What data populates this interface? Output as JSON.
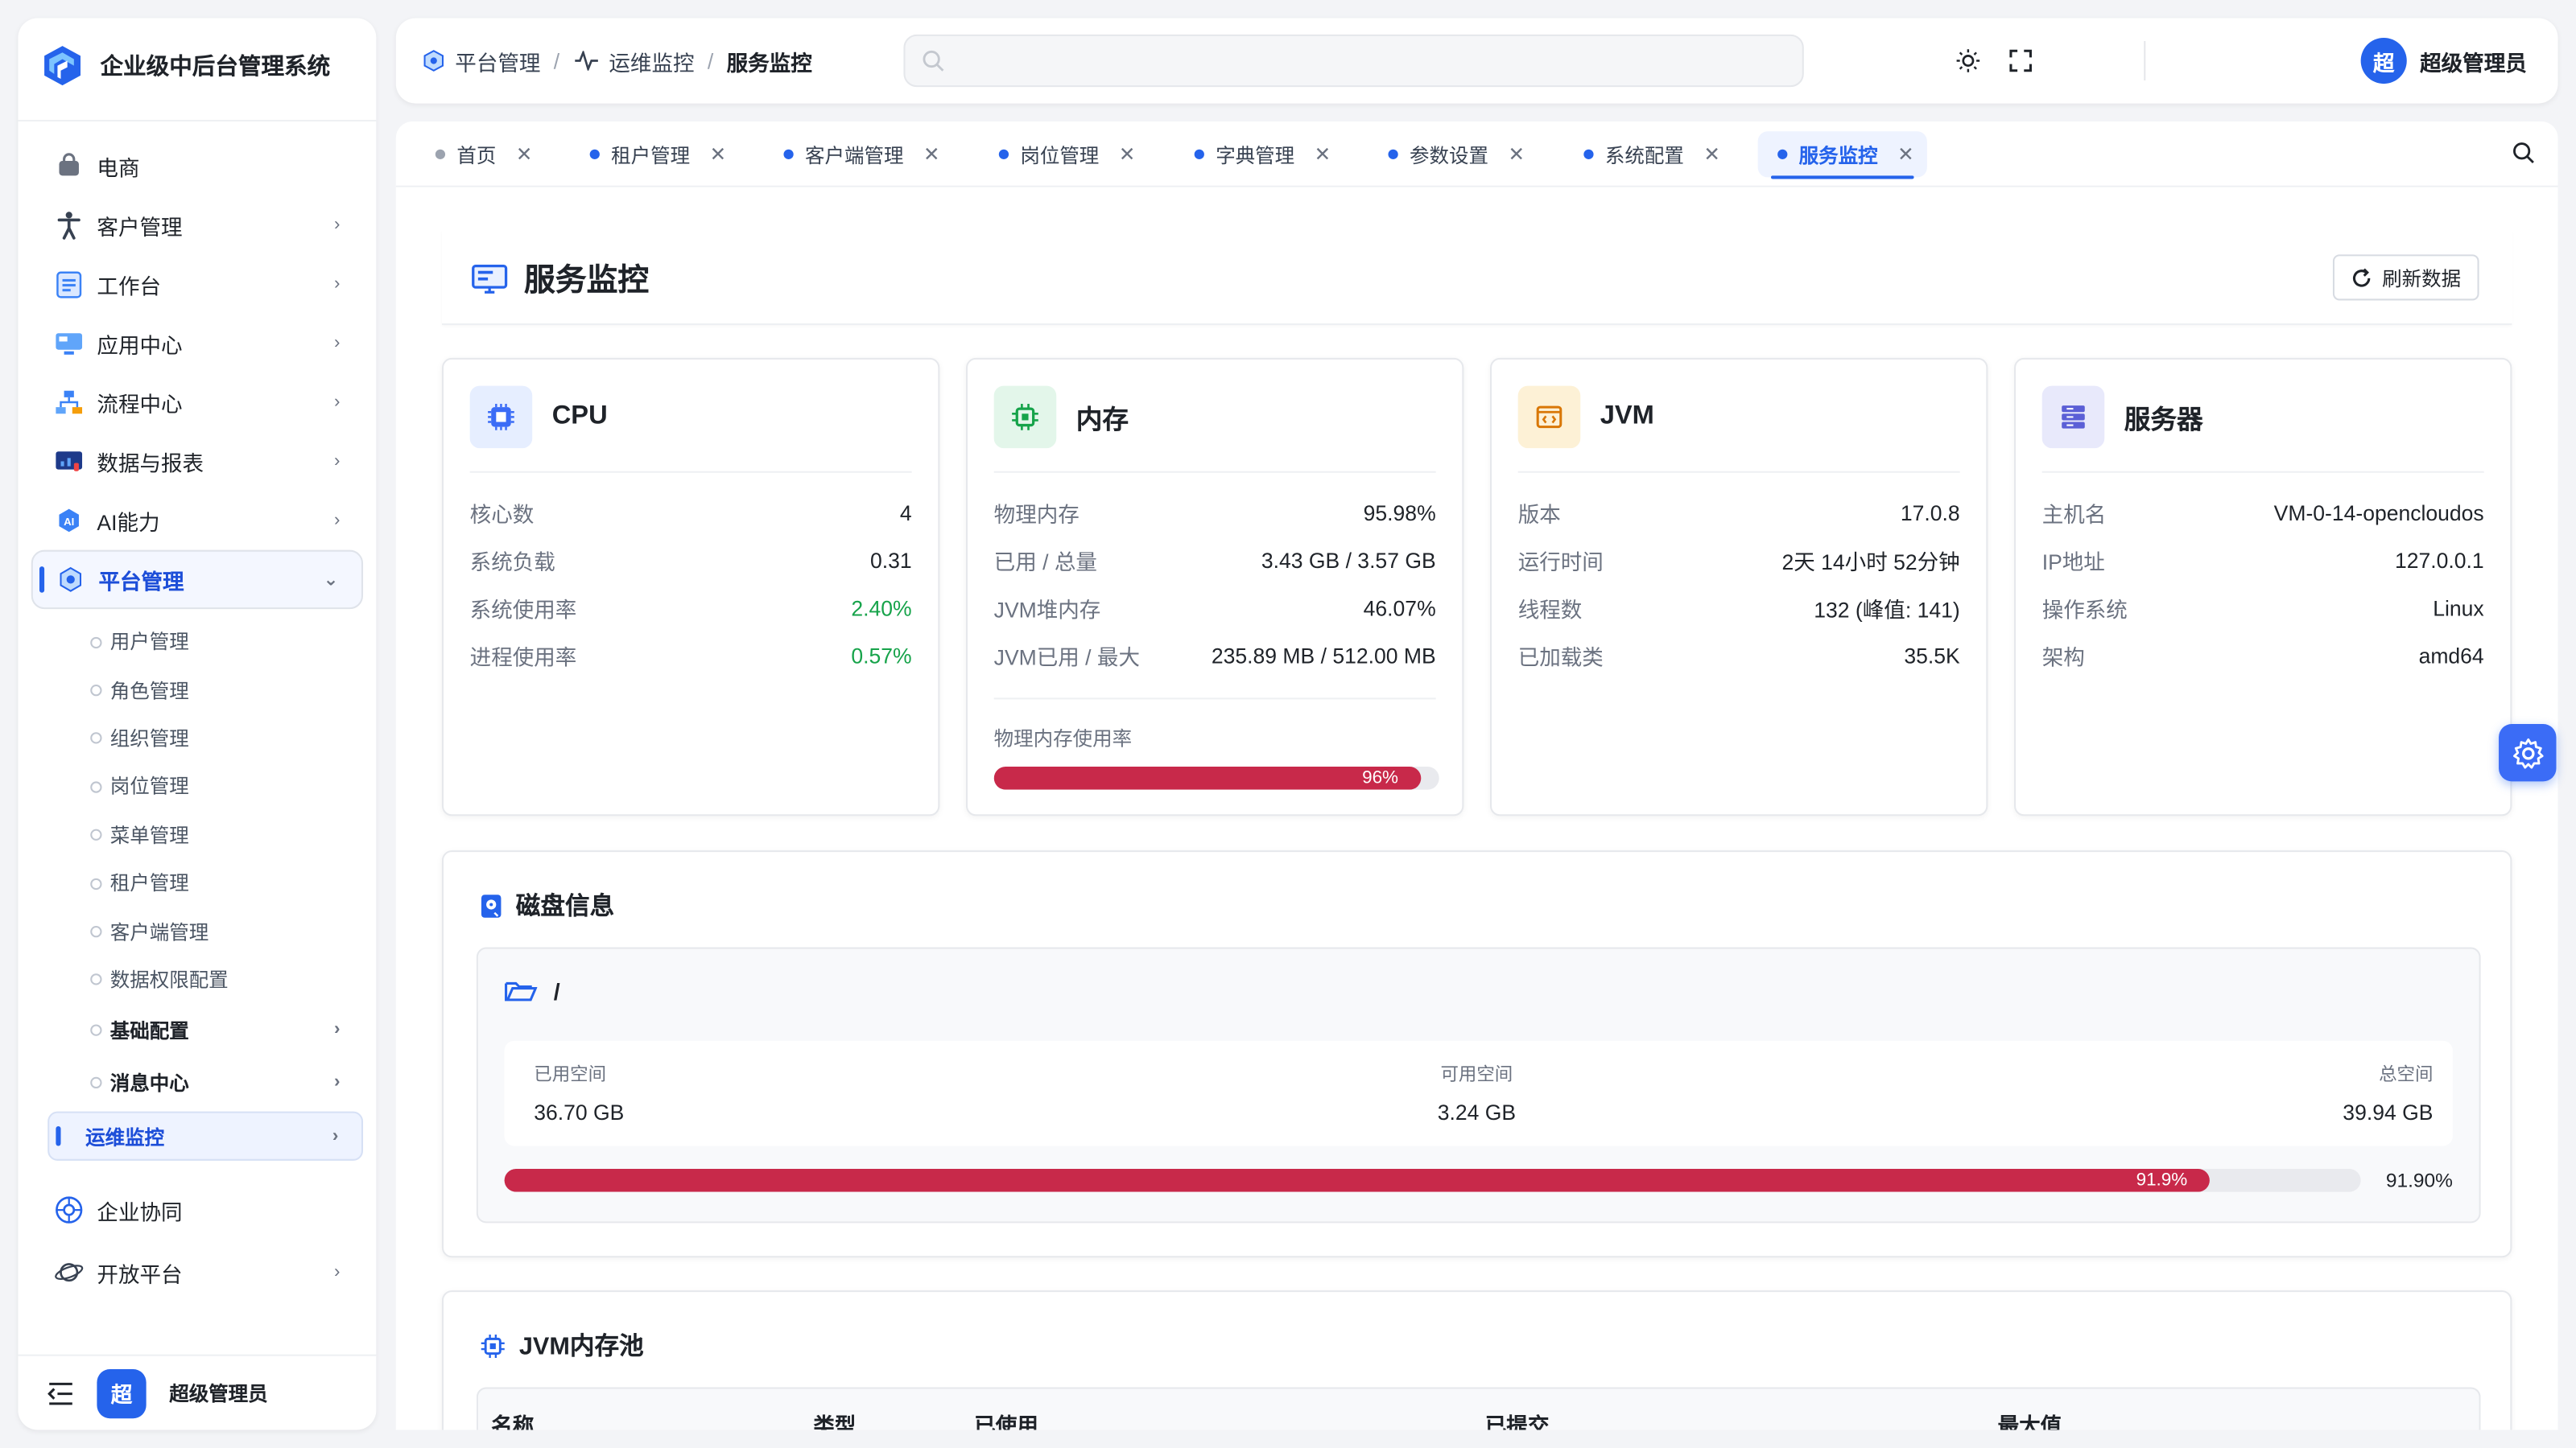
{
  "app": {
    "title": "企业级中后台管理系统"
  },
  "sidebar": {
    "items": [
      {
        "label": "电商",
        "icon": "shopping-bag-icon",
        "has_children": false
      },
      {
        "label": "客户管理",
        "icon": "person-icon",
        "has_children": true
      },
      {
        "label": "工作台",
        "icon": "clipboard-icon",
        "has_children": true
      },
      {
        "label": "应用中心",
        "icon": "monitor-icon",
        "has_children": true
      },
      {
        "label": "流程中心",
        "icon": "flowchart-icon",
        "has_children": true
      },
      {
        "label": "数据与报表",
        "icon": "chart-screen-icon",
        "has_children": true
      },
      {
        "label": "AI能力",
        "icon": "ai-icon",
        "has_children": true
      },
      {
        "label": "平台管理",
        "icon": "gear-cube-icon",
        "has_children": true,
        "expanded": true
      }
    ],
    "platform_children": [
      "用户管理",
      "角色管理",
      "组织管理",
      "岗位管理",
      "菜单管理",
      "租户管理",
      "客户端管理",
      "数据权限配置",
      "基础配置",
      "消息中心",
      "运维监控"
    ],
    "after_items": [
      {
        "label": "企业协同",
        "icon": "collab-icon"
      },
      {
        "label": "开放平台",
        "icon": "planet-icon"
      }
    ],
    "footer_user": {
      "avatar": "超",
      "name": "超级管理员"
    }
  },
  "header": {
    "breadcrumb": [
      "平台管理",
      "运维监控",
      "服务监控"
    ],
    "search": {
      "placeholder": "",
      "value": ""
    },
    "user": {
      "avatar": "超",
      "name": "超级管理员"
    }
  },
  "tabs": [
    {
      "label": "首页",
      "active": false
    },
    {
      "label": "租户管理",
      "active": false
    },
    {
      "label": "客户端管理",
      "active": false
    },
    {
      "label": "岗位管理",
      "active": false
    },
    {
      "label": "字典管理",
      "active": false
    },
    {
      "label": "参数设置",
      "active": false
    },
    {
      "label": "系统配置",
      "active": false
    },
    {
      "label": "服务监控",
      "active": true
    }
  ],
  "page": {
    "title": "服务监控",
    "refresh_label": "刷新数据"
  },
  "cards": {
    "cpu": {
      "title": "CPU",
      "rows": [
        {
          "k": "核心数",
          "v": "4"
        },
        {
          "k": "系统负载",
          "v": "0.31"
        },
        {
          "k": "系统使用率",
          "v": "2.40%",
          "status": "good"
        },
        {
          "k": "进程使用率",
          "v": "0.57%",
          "status": "good"
        }
      ]
    },
    "memory": {
      "title": "内存",
      "rows": [
        {
          "k": "物理内存",
          "v": "95.98%"
        },
        {
          "k": "已用 / 总量",
          "v": "3.43 GB / 3.57 GB"
        },
        {
          "k": "JVM堆内存",
          "v": "46.07%"
        },
        {
          "k": "JVM已用 / 最大",
          "v": "235.89 MB / 512.00 MB"
        }
      ],
      "usage_label": "物理内存使用率",
      "usage_pct": 96,
      "usage_text": "96%"
    },
    "jvm": {
      "title": "JVM",
      "rows": [
        {
          "k": "版本",
          "v": "17.0.8"
        },
        {
          "k": "运行时间",
          "v": "2天 14小时 52分钟"
        },
        {
          "k": "线程数",
          "v": "132 (峰值: 141)"
        },
        {
          "k": "已加载类",
          "v": "35.5K"
        }
      ]
    },
    "server": {
      "title": "服务器",
      "rows": [
        {
          "k": "主机名",
          "v": "VM-0-14-opencloudos"
        },
        {
          "k": "IP地址",
          "v": "127.0.0.1"
        },
        {
          "k": "操作系统",
          "v": "Linux"
        },
        {
          "k": "架构",
          "v": "amd64"
        }
      ]
    }
  },
  "disk": {
    "title": "磁盘信息",
    "path": "/",
    "used_label": "已用空间",
    "used": "36.70 GB",
    "free_label": "可用空间",
    "free": "3.24 GB",
    "total_label": "总空间",
    "total": "39.94 GB",
    "usage_pct": 91.9,
    "bar_text": "91.9%",
    "pct_text": "91.90%"
  },
  "jvm_pool": {
    "title": "JVM内存池",
    "columns": [
      "名称",
      "类型",
      "已使用",
      "已提交",
      "最大值"
    ]
  },
  "colors": {
    "accent": "#2563eb",
    "danger_bar": "#c8294a",
    "good": "#16a34a"
  }
}
